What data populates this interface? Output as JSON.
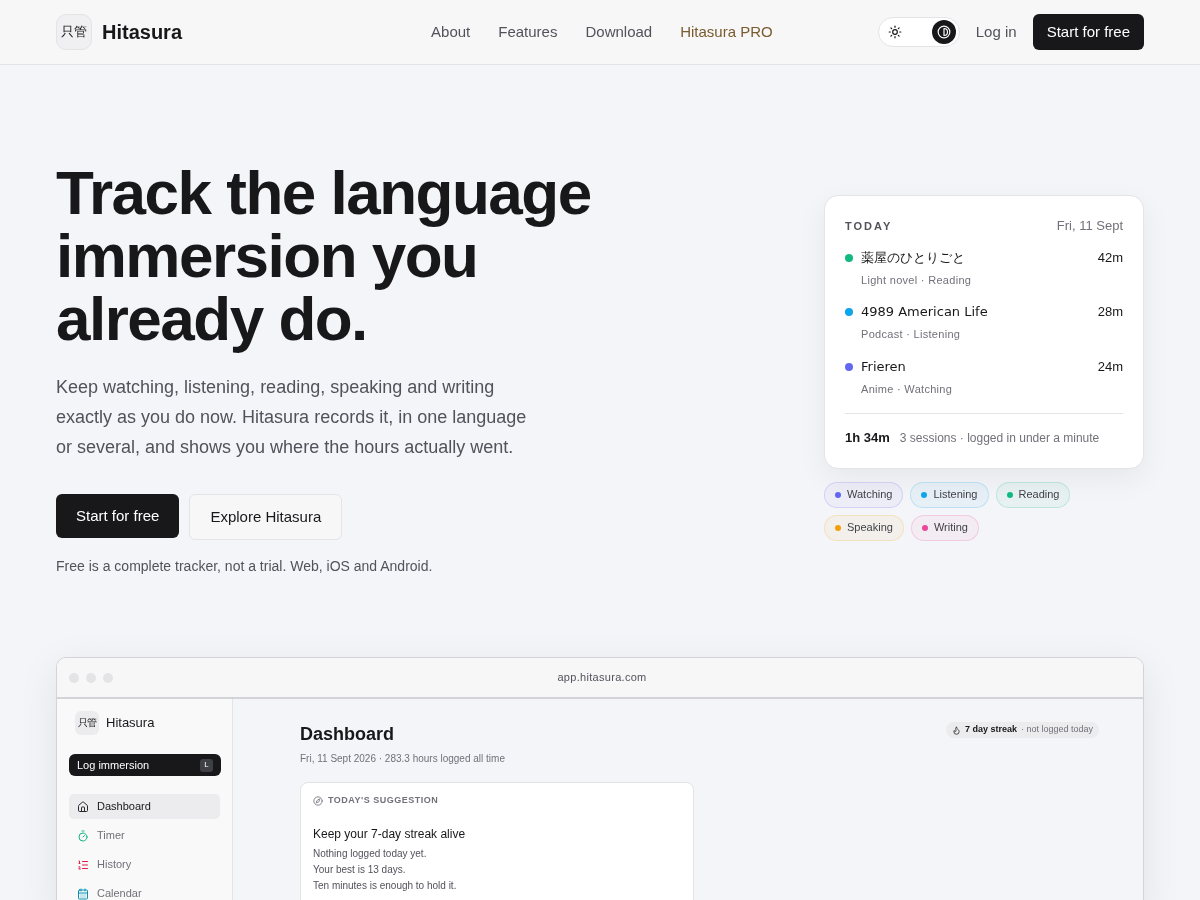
{
  "header": {
    "logo_mark": "只管",
    "brand": "Hitasura",
    "nav": [
      {
        "label": "About",
        "kind": "link"
      },
      {
        "label": "Features",
        "kind": "link"
      },
      {
        "label": "Download",
        "kind": "link"
      },
      {
        "label": "Hitasura PRO",
        "kind": "pro"
      }
    ],
    "theme_toggle": {
      "on": true
    },
    "login": "Log in",
    "cta": "Start for free"
  },
  "hero": {
    "title": "Track the language immersion you already do.",
    "lead": "Keep watching, listening, reading, speaking and writing exactly as you do now. Hitasura records it, in one language or several, and shows you where the hours actually went.",
    "buttons": [
      {
        "label": "Start for free",
        "kind": "primary"
      },
      {
        "label": "Explore Hitasura",
        "kind": "secondary"
      }
    ],
    "note": "Free is a complete tracker, not a trial. Web, iOS and Android."
  },
  "today_card": {
    "label": "TODAY",
    "date": "Fri, 11 Sept",
    "sessions": [
      {
        "title": "薬屋のひとりごと",
        "meta": "Light novel · Reading",
        "duration": "42m",
        "color": "#10b981"
      },
      {
        "title": "4989 American Life",
        "meta": "Podcast · Listening",
        "duration": "28m",
        "color": "#0ea5e9"
      },
      {
        "title": "Frieren",
        "meta": "Anime · Watching",
        "duration": "24m",
        "color": "#6366f1"
      }
    ],
    "total": "1h 34m",
    "summary": "3 sessions · logged in under a minute"
  },
  "activity_tags": [
    {
      "label": "Watching",
      "color": "#6366f1"
    },
    {
      "label": "Listening",
      "color": "#0ea5e9"
    },
    {
      "label": "Reading",
      "color": "#10b981"
    },
    {
      "label": "Speaking",
      "color": "#f59e0b"
    },
    {
      "label": "Writing",
      "color": "#ec4899"
    }
  ],
  "app_preview": {
    "url": "app.hitasura.com",
    "logo_mark": "只管",
    "brand": "Hitasura",
    "log_button": "Log immersion",
    "shortcut": "L",
    "sidebar": [
      {
        "label": "Dashboard",
        "kind": "home",
        "selected": true
      },
      {
        "label": "Timer",
        "kind": "timer",
        "selected": false
      },
      {
        "label": "History",
        "kind": "list",
        "selected": false
      },
      {
        "label": "Calendar",
        "kind": "calendar",
        "selected": false
      }
    ],
    "title": "Dashboard",
    "subtitle": "Fri, 11 Sept 2026 · 283.3 hours logged all time",
    "streak": "7 day streak",
    "streak_note": "· not logged today",
    "suggestion": {
      "label": "TODAY'S SUGGESTION",
      "heading": "Keep your 7-day streak alive",
      "lines": [
        "Nothing logged today yet.",
        "Your best is 13 days.",
        "Ten minutes is enough to hold it."
      ]
    }
  }
}
